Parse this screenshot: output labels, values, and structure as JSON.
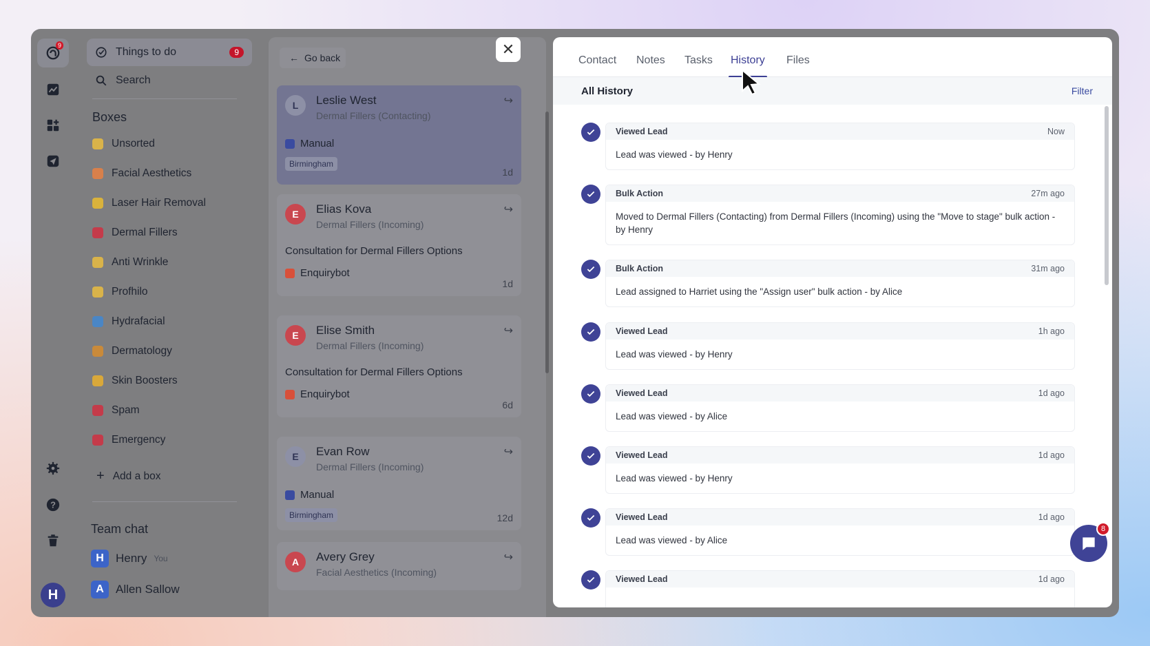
{
  "rail": {
    "logo_badge": "9",
    "avatar_letter": "H"
  },
  "sidebar": {
    "todo_label": "Things to do",
    "todo_count": "9",
    "search_label": "Search",
    "boxes_title": "Boxes",
    "boxes": [
      {
        "label": "Unsorted",
        "color": "#d9b34a"
      },
      {
        "label": "Facial Aesthetics",
        "color": "#d8804b"
      },
      {
        "label": "Laser Hair Removal",
        "color": "#d9b23c"
      },
      {
        "label": "Dermal Fillers",
        "color": "#c43b4a"
      },
      {
        "label": "Anti Wrinkle",
        "color": "#d9b34a"
      },
      {
        "label": "Profhilo",
        "color": "#d9b34a"
      },
      {
        "label": "Hydrafacial",
        "color": "#4a86c5"
      },
      {
        "label": "Dermatology",
        "color": "#c98a3a"
      },
      {
        "label": "Skin Boosters",
        "color": "#d9a83a"
      },
      {
        "label": "Spam",
        "color": "#c43b4a"
      },
      {
        "label": "Emergency",
        "color": "#c43b4a"
      }
    ],
    "add_box_label": "Add a box",
    "team_chat_title": "Team chat",
    "users": [
      {
        "initial": "H",
        "name": "Henry",
        "tag": "You",
        "color": "#3c64c8"
      },
      {
        "initial": "A",
        "name": "Allen Sallow",
        "tag": "",
        "color": "#3c64c8"
      }
    ]
  },
  "leads": {
    "go_back": "Go back",
    "cards": [
      {
        "initial": "L",
        "name": "Leslie West",
        "stage": "Dermal Fillers (Contacting)",
        "note": "",
        "source": "Manual",
        "location": "Birmingham",
        "age": "1d"
      },
      {
        "initial": "E",
        "name": "Elias Kova",
        "stage": "Dermal Fillers (Incoming)",
        "note": "Consultation for Dermal Fillers Options",
        "source": "Enquirybot",
        "location": "",
        "age": "1d"
      },
      {
        "initial": "E",
        "name": "Elise Smith",
        "stage": "Dermal Fillers (Incoming)",
        "note": "Consultation for Dermal Fillers Options",
        "source": "Enquirybot",
        "location": "",
        "age": "6d"
      },
      {
        "initial": "E",
        "name": "Evan Row",
        "stage": "Dermal Fillers (Incoming)",
        "note": "",
        "source": "Manual",
        "location": "Birmingham",
        "age": "12d"
      },
      {
        "initial": "A",
        "name": "Avery Grey",
        "stage": "Facial Aesthetics (Incoming)",
        "note": "",
        "source": "",
        "location": "",
        "age": ""
      }
    ]
  },
  "panel": {
    "close_glyph": "✕",
    "tabs": [
      "Contact",
      "Notes",
      "Tasks",
      "History",
      "Files"
    ],
    "active_tab": "History",
    "history_title": "All History",
    "filter_label": "Filter",
    "entries": [
      {
        "type": "Viewed Lead",
        "time": "Now",
        "text": "Lead was viewed - by Henry"
      },
      {
        "type": "Bulk Action",
        "time": "27m ago",
        "text": "Moved to Dermal Fillers (Contacting) from Dermal Fillers (Incoming) using the \"Move to stage\" bulk action - by Henry"
      },
      {
        "type": "Bulk Action",
        "time": "31m ago",
        "text": "Lead assigned to Harriet using the \"Assign user\" bulk action - by Alice"
      },
      {
        "type": "Viewed Lead",
        "time": "1h ago",
        "text": "Lead was viewed - by Henry"
      },
      {
        "type": "Viewed Lead",
        "time": "1d ago",
        "text": "Lead was viewed - by Alice"
      },
      {
        "type": "Viewed Lead",
        "time": "1d ago",
        "text": "Lead was viewed - by Henry"
      },
      {
        "type": "Viewed Lead",
        "time": "1d ago",
        "text": "Lead was viewed - by Alice"
      },
      {
        "type": "Viewed Lead",
        "time": "1d ago",
        "text": ""
      }
    ],
    "chat_badge": "8"
  },
  "colors": {
    "accent": "#3f4396",
    "badge": "#d11a2a",
    "overlay": "#7e7e80"
  }
}
